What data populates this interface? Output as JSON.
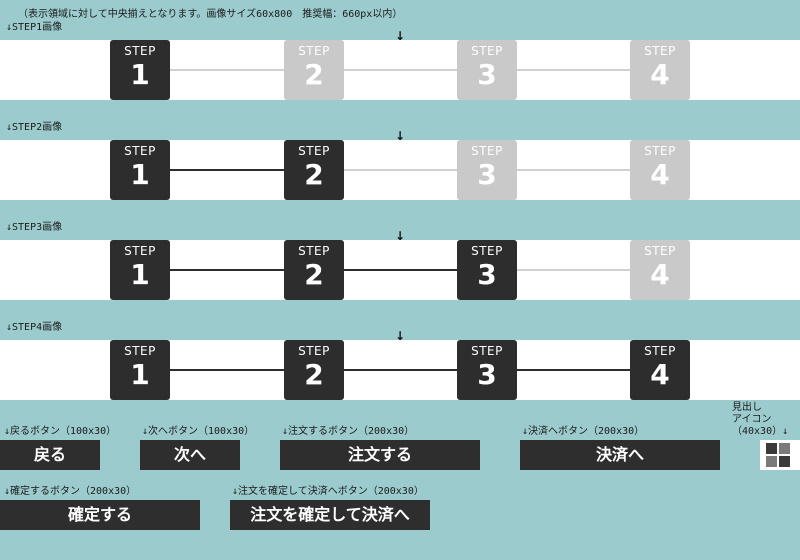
{
  "header_note": "（表示領域に対して中央揃えとなります。画像サイズ60x800　推奨幅：660px以内）",
  "center_arrow": "↓",
  "step_word": "STEP",
  "rows": [
    {
      "label": "↓STEP1画像",
      "steps": [
        {
          "num": "1",
          "state": "done"
        },
        {
          "num": "2",
          "state": "todo"
        },
        {
          "num": "3",
          "state": "todo"
        },
        {
          "num": "4",
          "state": "todo"
        }
      ]
    },
    {
      "label": "↓STEP2画像",
      "steps": [
        {
          "num": "1",
          "state": "done"
        },
        {
          "num": "2",
          "state": "done"
        },
        {
          "num": "3",
          "state": "todo"
        },
        {
          "num": "4",
          "state": "todo"
        }
      ]
    },
    {
      "label": "↓STEP3画像",
      "steps": [
        {
          "num": "1",
          "state": "done"
        },
        {
          "num": "2",
          "state": "done"
        },
        {
          "num": "3",
          "state": "done"
        },
        {
          "num": "4",
          "state": "todo"
        }
      ]
    },
    {
      "label": "↓STEP4画像",
      "steps": [
        {
          "num": "1",
          "state": "done"
        },
        {
          "num": "2",
          "state": "done"
        },
        {
          "num": "3",
          "state": "done"
        },
        {
          "num": "4",
          "state": "done"
        }
      ]
    }
  ],
  "buttons": {
    "back": {
      "note": "↓戻るボタン（100x30）",
      "label": "戻る"
    },
    "next": {
      "note": "↓次へボタン（100x30）",
      "label": "次へ"
    },
    "order": {
      "note": "↓注文するボタン（200x30）",
      "label": "注文する"
    },
    "payment": {
      "note": "↓決済へボタン（200x30）",
      "label": "決済へ"
    },
    "confirm": {
      "note": "↓確定するボタン（200x30）",
      "label": "確定する"
    },
    "confirm_pay": {
      "note": "↓注文を確定して決済へボタン（200x30）",
      "label": "注文を確定して決済へ"
    }
  },
  "heading_icon": {
    "note_line1": "見出し",
    "note_line2": "アイコン",
    "note_line3": "（40x30）↓",
    "icon": "square-grid-icon"
  },
  "colors": {
    "background": "#9bcbcd",
    "active": "#2d2d2d",
    "inactive": "#c9c9c9",
    "button": "#2e2e2e"
  }
}
